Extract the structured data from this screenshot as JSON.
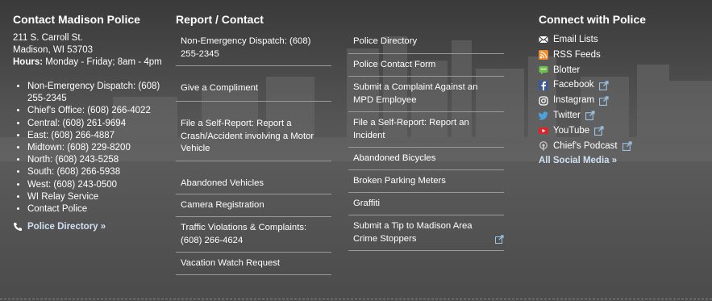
{
  "col1": {
    "heading": "Contact Madison Police",
    "address1": "211 S. Carroll St.",
    "address2": "Madison, WI 53703",
    "hours_label": "Hours:",
    "hours_value": " Monday - Friday; 8am - 4pm",
    "phones": [
      "Non-Emergency Dispatch: (608) 255-2345",
      "Chief's Office: (608) 266-4022",
      "Central: (608) 261-9694",
      "East: (608) 266-4887",
      "Midtown: (608) 229-8200",
      "North: (608) 243-5258",
      "South: (608) 266-5938",
      "West: (608) 243-0500",
      "WI Relay Service",
      "Contact Police"
    ],
    "directory_link": "Police Directory »",
    "directory_icon": "phone-icon"
  },
  "col2": {
    "heading": "Report / Contact",
    "left": [
      "Non-Emergency Dispatch: (608) 255-2345",
      "Give a Compliment",
      "File a Self-Report: Report a Crash/Accident involving a Motor Vehicle",
      "Abandoned Vehicles",
      "Camera Registration",
      "Traffic Violations & Complaints: (608) 266-4624",
      "Vacation Watch Request"
    ],
    "right": [
      "Police Directory",
      "Police Contact Form",
      "Submit a Complaint Against an MPD Employee",
      "File a Self-Report: Report an Incident",
      "Abandoned Bicycles",
      "Broken Parking Meters",
      "Graffiti",
      "Submit a Tip to Madison Area Crime Stoppers"
    ]
  },
  "col3": {
    "heading": "Connect with Police",
    "links": [
      {
        "label": "Email Lists",
        "icon": "email-icon"
      },
      {
        "label": "RSS Feeds",
        "icon": "rss-icon"
      },
      {
        "label": "Blotter",
        "icon": "blotter-icon"
      },
      {
        "label": "Facebook",
        "icon": "facebook-icon"
      },
      {
        "label": "Instagram",
        "icon": "instagram-icon"
      },
      {
        "label": "Twitter",
        "icon": "twitter-icon"
      },
      {
        "label": "YouTube",
        "icon": "youtube-icon"
      },
      {
        "label": "Chief's Podcast",
        "icon": "podcast-icon"
      }
    ],
    "all_social": "All Social Media »"
  },
  "colors": {
    "background": "#4a4a4a",
    "link_accent": "#cfe0f2",
    "divider": "#9a9a9a"
  }
}
